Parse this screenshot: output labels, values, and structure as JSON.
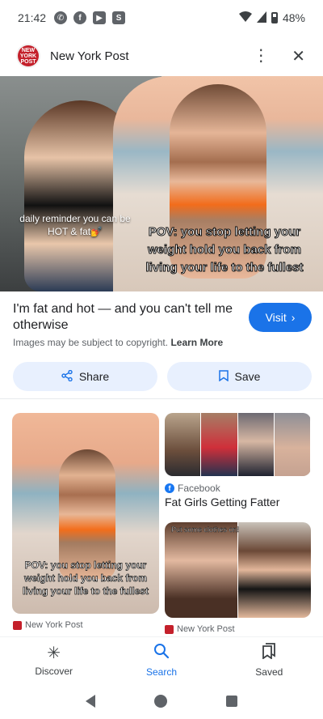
{
  "status_bar": {
    "time": "21:42",
    "battery": "48%"
  },
  "header": {
    "site_name": "New York Post",
    "favicon_text": "NEW YORK POST"
  },
  "hero": {
    "caption_left": "daily reminder you can be HOT & fat💅",
    "caption_right": "POV: you stop letting your weight hold you back from living your life to the fullest"
  },
  "result": {
    "title": "I'm fat and hot — and you can't tell me otherwise",
    "visit_label": "Visit",
    "copyright_text": "Images may be subject to copyright.",
    "learn_more_label": "Learn More"
  },
  "actions": {
    "share_label": "Share",
    "save_label": "Save"
  },
  "related": [
    {
      "caption": "POV: you stop letting your weight hold you back from living your life to the fullest",
      "source": "New York Post"
    },
    {
      "source": "Facebook",
      "title": "Fat Girls Getting Fatter"
    },
    {
      "caption": "Put some clothes on!",
      "source": "New York Post"
    }
  ],
  "bottom_nav": {
    "items": [
      {
        "label": "Discover",
        "icon": "asterisk-icon"
      },
      {
        "label": "Search",
        "icon": "search-icon"
      },
      {
        "label": "Saved",
        "icon": "bookmarks-icon"
      }
    ]
  },
  "colors": {
    "accent": "#1a73e8",
    "pill_bg": "#e8f0fe",
    "brand_red": "#c4202b"
  }
}
